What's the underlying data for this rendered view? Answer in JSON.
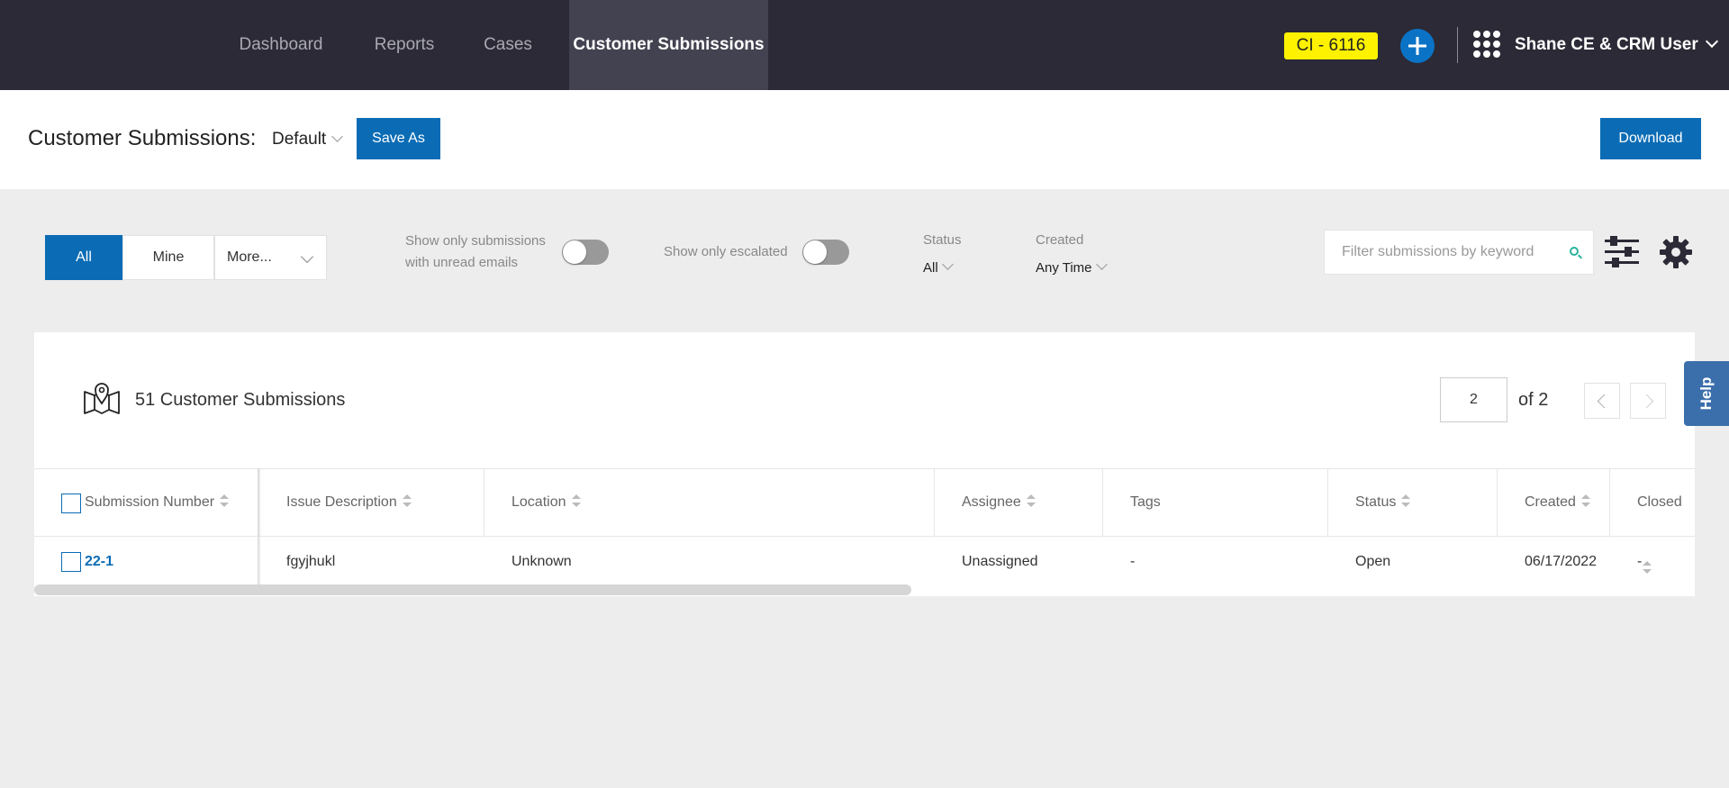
{
  "nav": {
    "tabs": [
      {
        "label": "Dashboard"
      },
      {
        "label": "Reports"
      },
      {
        "label": "Cases"
      },
      {
        "label": "Customer Submissions"
      }
    ],
    "env_badge": "CI - 6116",
    "user_name": "Shane CE & CRM User"
  },
  "titlebar": {
    "title": "Customer Submissions:",
    "view_name": "Default",
    "save_as_label": "Save As",
    "download_label": "Download"
  },
  "filters": {
    "segments": {
      "all": "All",
      "mine": "Mine",
      "more": "More..."
    },
    "unread_toggle_label_1": "Show only submissions",
    "unread_toggle_label_2": "with unread emails",
    "escalated_toggle_label": "Show only escalated",
    "status_label": "Status",
    "status_value": "All",
    "created_label": "Created",
    "created_value": "Any Time",
    "search_placeholder": "Filter submissions by keyword"
  },
  "results": {
    "count_text": "51 Customer Submissions",
    "page_current": "2",
    "page_of_text": "of 2"
  },
  "table": {
    "columns": [
      "Submission Number",
      "Issue Description",
      "Location",
      "Assignee",
      "Tags",
      "Status",
      "Created",
      "Closed"
    ],
    "rows": [
      [
        "22-1",
        "fgyjhukl",
        "Unknown",
        "Unassigned",
        "-",
        "Open",
        "06/17/2022",
        "-"
      ]
    ]
  },
  "help_label": "Help",
  "colors": {
    "nav_bg": "#2b2a36",
    "primary": "#0b6cb5",
    "badge": "#fff200",
    "help": "#3b6fab"
  }
}
